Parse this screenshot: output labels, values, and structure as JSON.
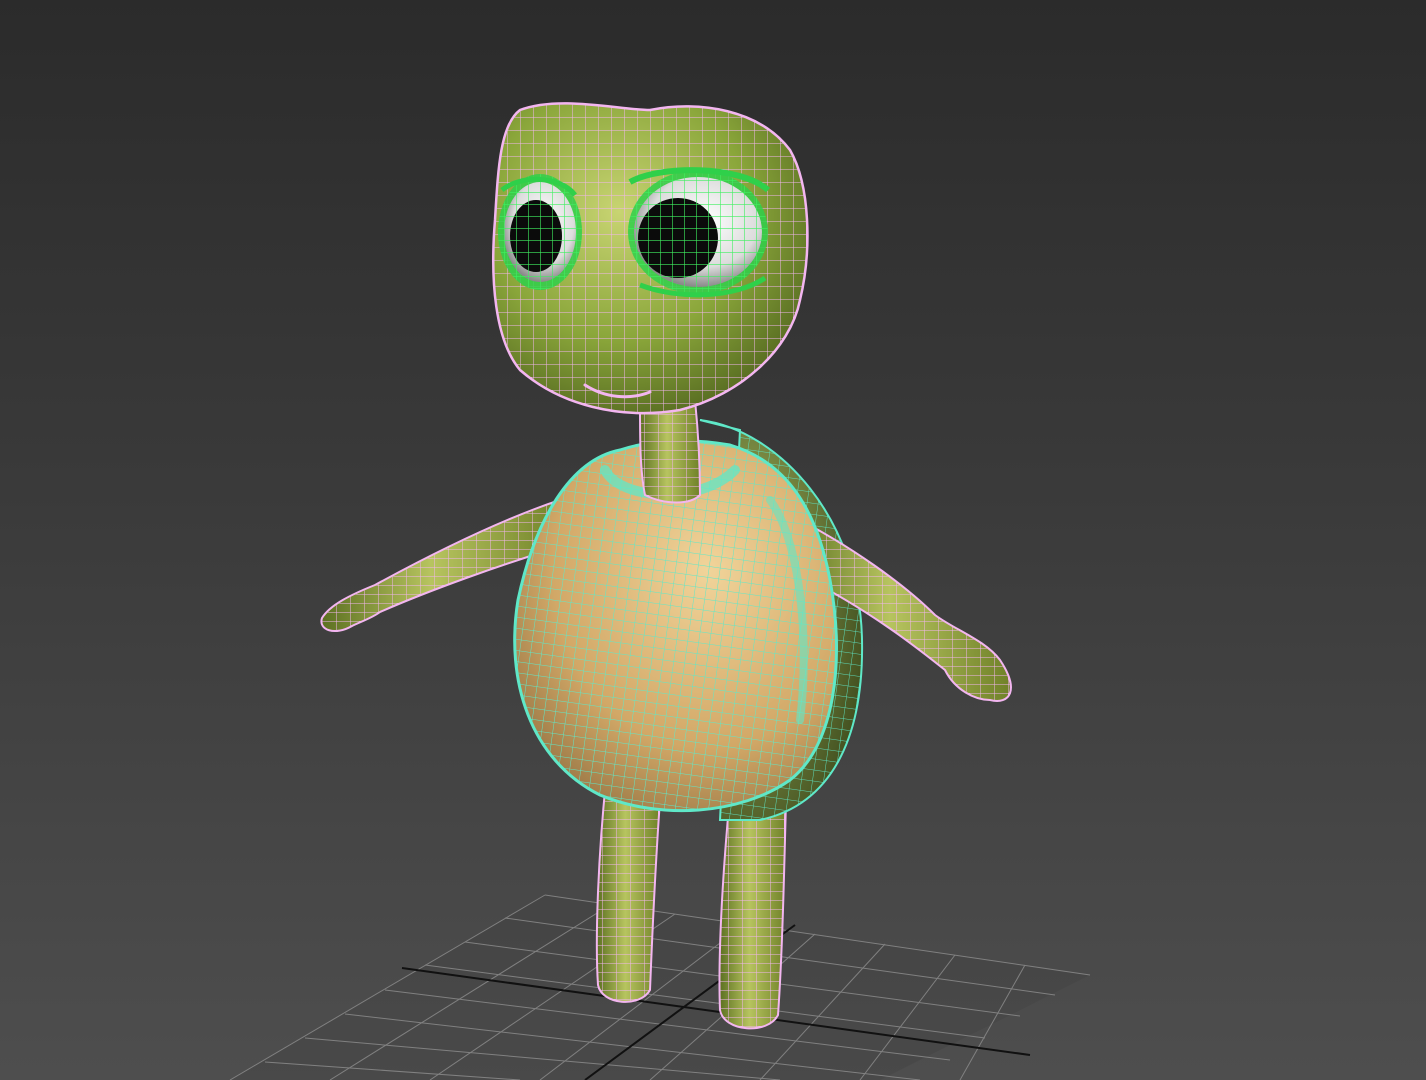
{
  "viewport": {
    "background_top": "#2b2b2b",
    "background_bottom": "#4e4e4e",
    "shading_mode": "shaded-with-wireframe-edges"
  },
  "scene": {
    "model": "cartoon-turtle-character",
    "pose": "a-pose",
    "colors": {
      "skin": "#8aa63a",
      "skin_light": "#c3cf6a",
      "belly": "#d8b676",
      "shell": "#7e8f3e",
      "eye_white": "#f2f2f2",
      "eye_iris": "#2fd04a",
      "pupil": "#0b0b0b",
      "body_wire": "#f3b6f0",
      "shell_wire": "#5fe8c8",
      "eye_wire": "#3ff060"
    },
    "grid": {
      "line_color": "#8a8a8a",
      "axis_color": "#1a1a1a"
    }
  }
}
